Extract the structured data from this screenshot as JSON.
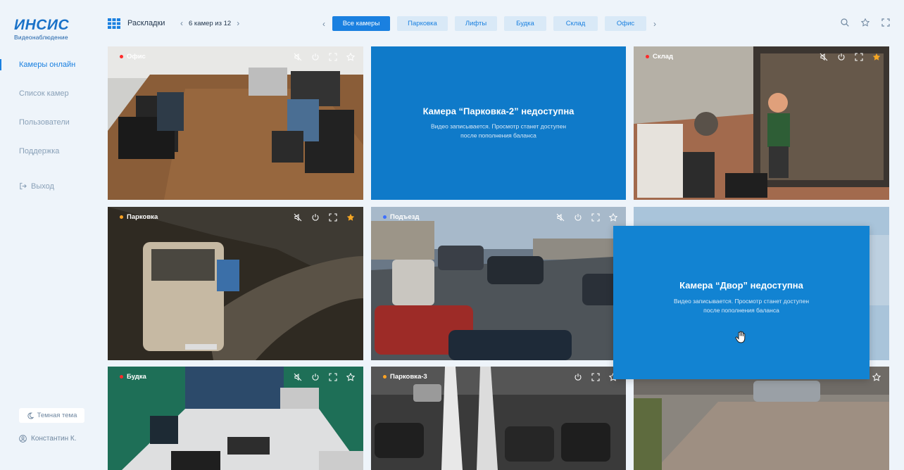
{
  "logo": {
    "brand": "ИНСИС",
    "subtitle": "Видеонаблюдение"
  },
  "nav": {
    "items": [
      {
        "label": "Камеры онлайн",
        "active": true
      },
      {
        "label": "Список камер",
        "active": false
      },
      {
        "label": "Пользователи",
        "active": false
      },
      {
        "label": "Поддержка",
        "active": false
      }
    ],
    "exit_label": "Выход",
    "theme_label": "Темная тема",
    "user_name": "Константин К."
  },
  "toolbar": {
    "layouts_label": "Раскладки",
    "pager_text": "6 камер из 12",
    "filters": [
      "Все камеры",
      "Парковка",
      "Лифты",
      "Будка",
      "Склад",
      "Офис"
    ],
    "active_filter": "Все камеры"
  },
  "colors": {
    "accent": "#1a80e0",
    "dot_red": "#ff2a2a",
    "dot_orange": "#ffa323",
    "dot_blue": "#3d6fff",
    "star_active": "#f5a623"
  },
  "cameras": [
    {
      "label": "Офис",
      "status_color": "#ff2a2a",
      "favorite": false,
      "muted": true
    },
    {
      "label": "",
      "unavailable": true,
      "title": "Камера “Парковка-2” недоступна",
      "line1": "Видео записывается. Просмотр станет доступен",
      "line2": "после пополнения баланса"
    },
    {
      "label": "Склад",
      "status_color": "#ff2a2a",
      "favorite": true,
      "muted": true
    },
    {
      "label": "Парковка",
      "status_color": "#ffa323",
      "favorite": true,
      "muted": true
    },
    {
      "label": "Подъезд",
      "status_color": "#3d6fff",
      "favorite": false,
      "muted": true
    },
    {
      "label": "Двор",
      "unavailable": true
    },
    {
      "label": "Будка",
      "status_color": "#ff2a2a",
      "favorite": false,
      "muted": true
    },
    {
      "label": "Парковка-3",
      "status_color": "#ffa323",
      "favorite": false,
      "muted": false
    }
  ],
  "popup": {
    "title": "Камера “Двор” недоступна",
    "line1": "Видео записывается. Просмотр станет доступен",
    "line2": "после пополнения баланса"
  }
}
